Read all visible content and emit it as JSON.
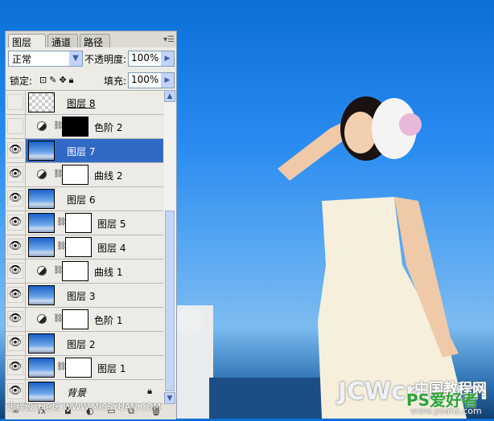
{
  "panel": {
    "tabs": [
      "图层",
      "通道",
      "路径"
    ],
    "close_glyph": "×",
    "blend_mode": "正常",
    "opacity_label": "不透明度:",
    "opacity": "100%",
    "lock_label": "锁定:",
    "fill_label": "填充:",
    "fill": "100%"
  },
  "layers": [
    {
      "name": "图层 8",
      "visible": false,
      "thumb": "check",
      "adjust": false,
      "mask": null,
      "underline": true
    },
    {
      "name": "色阶 2",
      "visible": false,
      "thumb": null,
      "adjust": true,
      "mask": "black"
    },
    {
      "name": "图层 7",
      "visible": true,
      "thumb": "photo",
      "adjust": false,
      "mask": null,
      "selected": true
    },
    {
      "name": "曲线 2",
      "visible": true,
      "thumb": null,
      "adjust": true,
      "mask": "white"
    },
    {
      "name": "图层 6",
      "visible": true,
      "thumb": "photo",
      "adjust": false,
      "mask": null
    },
    {
      "name": "图层 5",
      "visible": true,
      "thumb": "photo",
      "adjust": false,
      "mask": "white"
    },
    {
      "name": "图层 4",
      "visible": true,
      "thumb": "photo",
      "adjust": false,
      "mask": "white"
    },
    {
      "name": "曲线 1",
      "visible": true,
      "thumb": null,
      "adjust": true,
      "mask": "white"
    },
    {
      "name": "图层 3",
      "visible": true,
      "thumb": "photo",
      "adjust": false,
      "mask": null
    },
    {
      "name": "色阶 1",
      "visible": true,
      "thumb": null,
      "adjust": true,
      "mask": "white"
    },
    {
      "name": "图层 2",
      "visible": true,
      "thumb": "photo",
      "adjust": false,
      "mask": null
    },
    {
      "name": "图层 1",
      "visible": true,
      "thumb": "photo",
      "adjust": false,
      "mask": "white"
    },
    {
      "name": "背景",
      "visible": true,
      "thumb": "photo",
      "adjust": false,
      "mask": null,
      "locked": true,
      "italic": true
    }
  ],
  "watermarks": {
    "missyuan": "思缘设计论坛 WWW.MISSYUAN.COM",
    "jcwcn_cn": "中国教程网",
    "jcwcn": "JCWcn.com",
    "psahz": "PS爱好者",
    "psahz_url": "www.psahz.com"
  }
}
